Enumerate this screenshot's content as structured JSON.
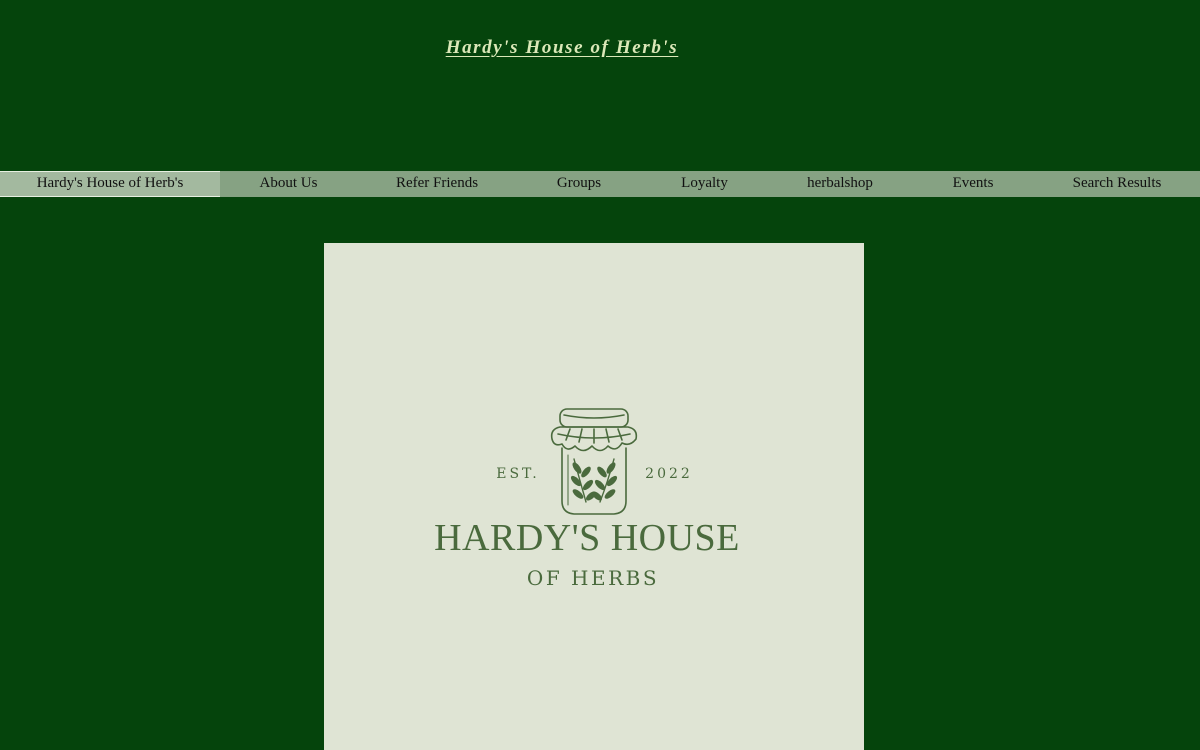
{
  "site": {
    "title": "Hardy's House of Herb's"
  },
  "nav": {
    "items": [
      {
        "label": "Hardy's House of Herb's",
        "active": true
      },
      {
        "label": "About Us"
      },
      {
        "label": "Refer Friends"
      },
      {
        "label": "Groups"
      },
      {
        "label": "Loyalty"
      },
      {
        "label": "herbalshop"
      },
      {
        "label": "Events"
      },
      {
        "label": "Search Results"
      }
    ]
  },
  "logo": {
    "est_label": "EST.",
    "year": "2022",
    "line1": "HARDY'S HOUSE",
    "line2": "OF HERBS",
    "icon": "herb-jar-icon"
  },
  "colors": {
    "background": "#05440c",
    "nav_bar": "#86a283",
    "nav_active": "#a3b99f",
    "title_text": "#dbe8b8",
    "logo_bg": "#dfe4d4",
    "logo_ink": "#4a6a3d"
  }
}
